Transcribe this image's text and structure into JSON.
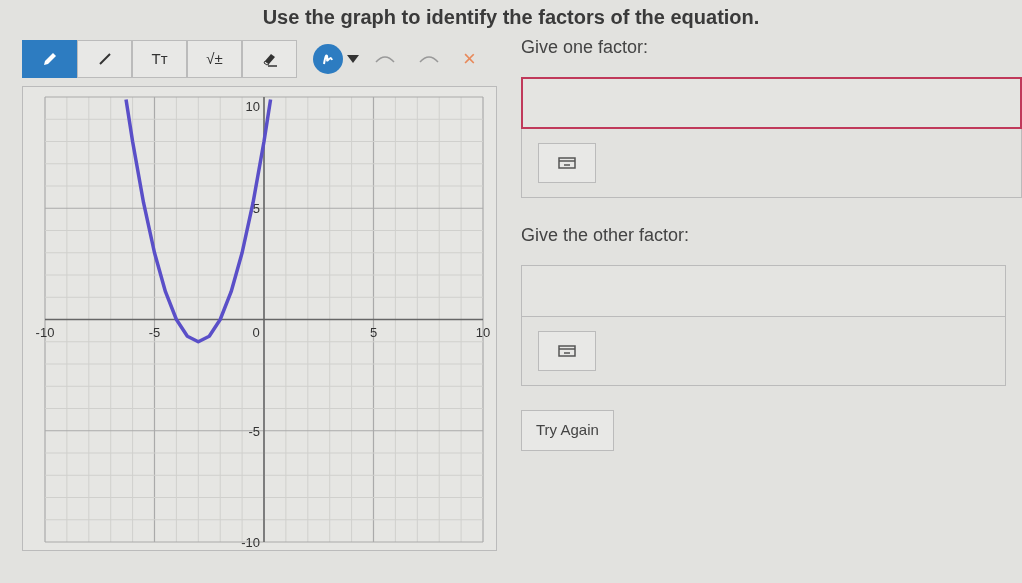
{
  "title": "Use the graph to identify the factors of the equation.",
  "toolbar": {
    "tools": [
      {
        "kind": "pencil",
        "selected": true
      },
      {
        "kind": "line",
        "selected": false
      },
      {
        "kind": "text",
        "label": "Tт",
        "selected": false
      },
      {
        "kind": "math",
        "label": "√±",
        "selected": false
      },
      {
        "kind": "eraser",
        "selected": false
      }
    ],
    "delete_label": "×"
  },
  "graph": {
    "chart_data": {
      "type": "line",
      "grid": true,
      "x": [
        -6.3,
        -6,
        -5.5,
        -5,
        -4.5,
        -4,
        -3.5,
        -3,
        -2.5,
        -2,
        -1.5,
        -1,
        -0.5,
        0,
        0.3
      ],
      "series": [
        {
          "color": "#5a4fc8",
          "values": [
            9.89,
            8,
            5.25,
            3,
            1.25,
            0,
            -0.75,
            -1,
            -0.75,
            0,
            1.25,
            3,
            5.25,
            8,
            9.89
          ]
        }
      ],
      "xlim": [
        -10,
        10
      ],
      "ylim": [
        -10,
        10
      ],
      "xticks": [
        {
          "value": -10,
          "label": "-10"
        },
        {
          "value": -5,
          "label": "-5"
        },
        {
          "value": 0,
          "label": "0"
        },
        {
          "value": 5,
          "label": "5"
        },
        {
          "value": 10,
          "label": "10"
        }
      ],
      "yticks": [
        {
          "value": 10,
          "label": "10"
        },
        {
          "value": 5,
          "label": "5"
        },
        {
          "value": -5,
          "label": "-5"
        },
        {
          "value": -10,
          "label": "-10"
        }
      ]
    }
  },
  "questions": [
    {
      "prompt": "Give one factor:",
      "marked_wrong": true
    },
    {
      "prompt": "Give the other factor:",
      "marked_wrong": false
    }
  ],
  "try_again": "Try Again"
}
